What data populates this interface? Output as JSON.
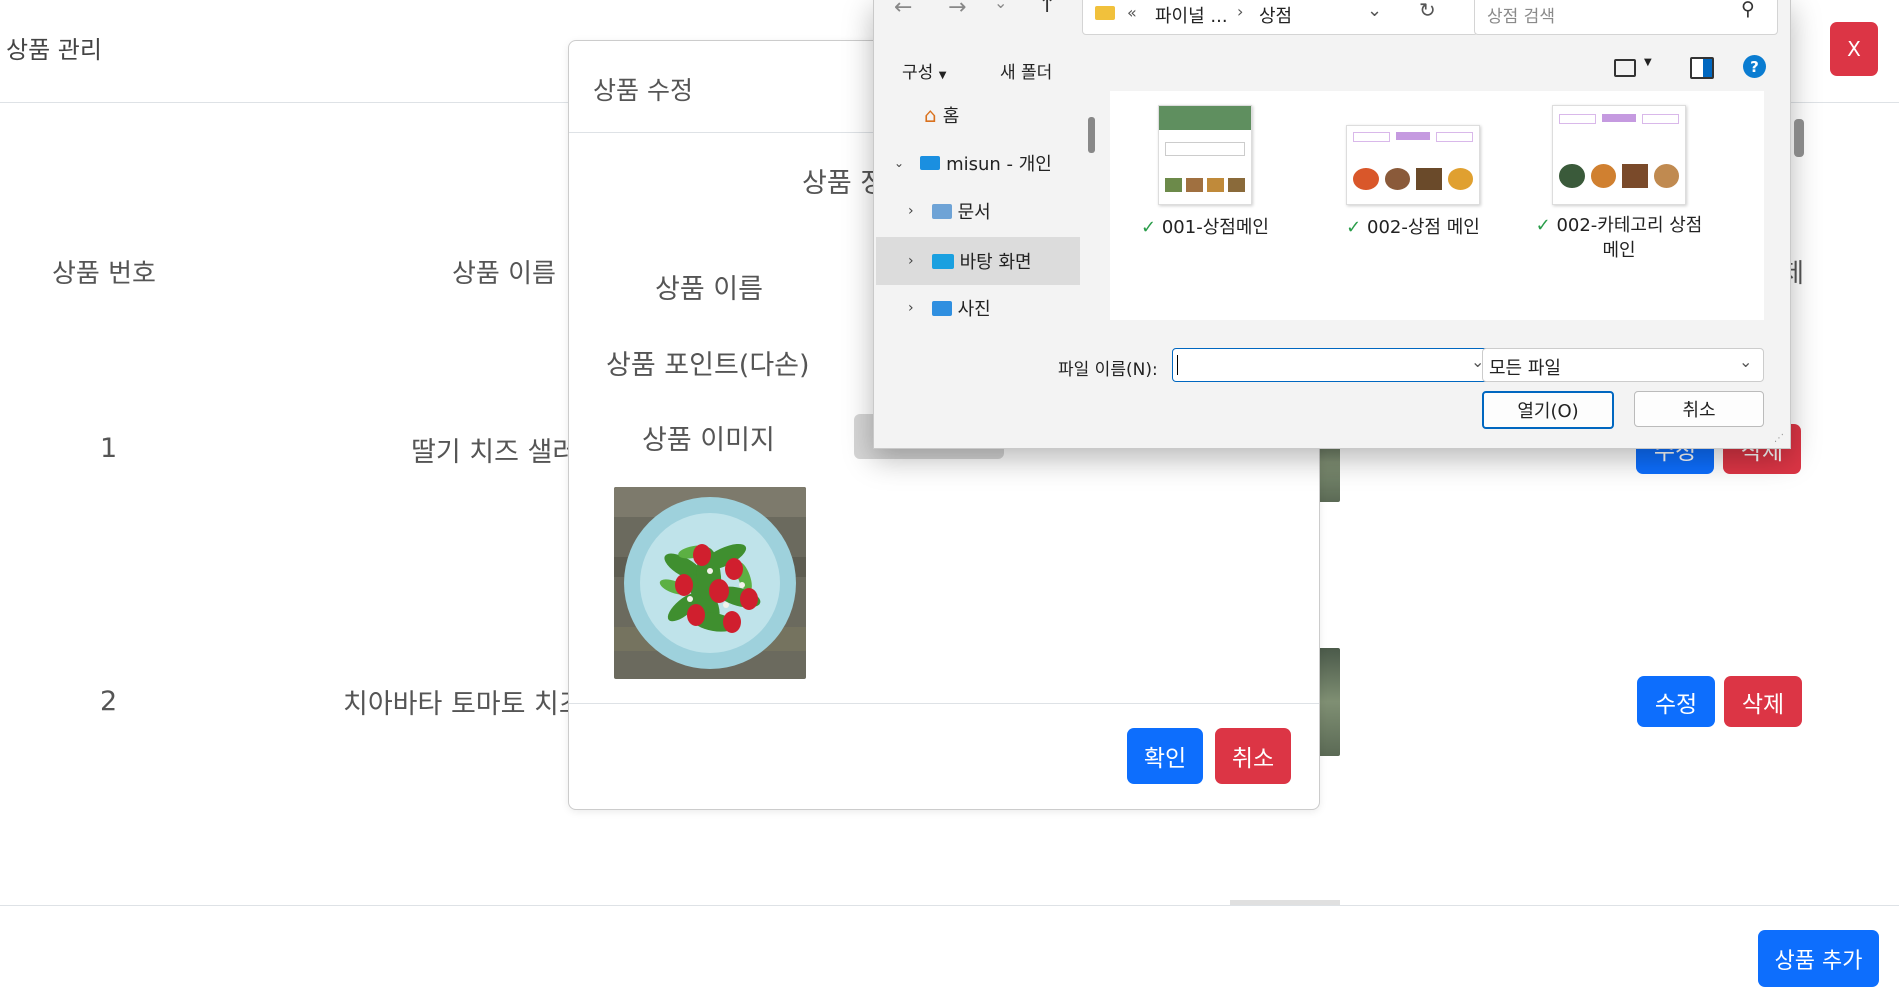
{
  "page": {
    "title": "상품 관리",
    "close_label": "X",
    "headers": {
      "no": "상품 번호",
      "name": "상품 이름",
      "delete": "삭제"
    },
    "rows": [
      {
        "no": "1",
        "name": "딸기 치즈 샐러드",
        "edit": "수정",
        "delete": "삭제"
      },
      {
        "no": "2",
        "name": "치아바타 토마토 치즈",
        "edit": "수정",
        "delete": "삭제"
      }
    ],
    "add_button": "상품 추가"
  },
  "modal": {
    "title": "상품 수정",
    "section_title": "상품 정보",
    "labels": {
      "name": "상품 이름",
      "point": "상품 포인트(다손)",
      "image": "상품 이미지"
    },
    "confirm": "확인",
    "cancel": "취소"
  },
  "dialog": {
    "breadcrumb": {
      "prefix": "«",
      "parent": "파이널 ...",
      "current": "상점"
    },
    "search_placeholder": "상점 검색",
    "toolbar": {
      "organize": "구성",
      "new_folder": "새 폴더"
    },
    "nav": [
      {
        "label": "홈",
        "icon": "home-icon"
      },
      {
        "label": "misun - 개인",
        "icon": "cloud-folder-icon"
      },
      {
        "label": "문서",
        "icon": "documents-folder-icon"
      },
      {
        "label": "바탕 화면",
        "icon": "desktop-folder-icon"
      },
      {
        "label": "사진",
        "icon": "pictures-folder-icon"
      }
    ],
    "files": [
      {
        "name": "001-상점메인"
      },
      {
        "name": "002-상점 메인"
      },
      {
        "name": "002-카테고리 상점 메인"
      }
    ],
    "filename_label": "파일 이름(N):",
    "filename_value": "",
    "filetype": "모든 파일",
    "open": "열기(O)",
    "cancel": "취소"
  },
  "colors": {
    "primary": "#0d6efd",
    "danger": "#dc3545",
    "dialog_accent": "#0067c0"
  }
}
